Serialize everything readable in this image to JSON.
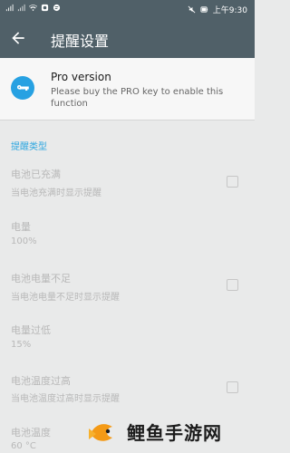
{
  "status_bar": {
    "time": "上午9:30"
  },
  "header": {
    "title": "提醒设置"
  },
  "pro": {
    "title": "Pro version",
    "subtitle": "Please buy the PRO key to enable this function"
  },
  "section": {
    "title": "提醒类型"
  },
  "settings": [
    {
      "title": "电池已充满",
      "subtitle": "当电池充满时显示提醒",
      "checked": false
    },
    {
      "title": "电量",
      "subtitle": "100%"
    },
    {
      "title": "电池电量不足",
      "subtitle": "当电池电量不足时显示提醒",
      "checked": false
    },
    {
      "title": "电量过低",
      "subtitle": "15%"
    },
    {
      "title": "电池温度过高",
      "subtitle": "当电池温度过高时显示提醒",
      "checked": false
    },
    {
      "title": "电池温度",
      "subtitle": "60 °C"
    }
  ],
  "watermark": {
    "text": "鲤鱼手游网"
  }
}
